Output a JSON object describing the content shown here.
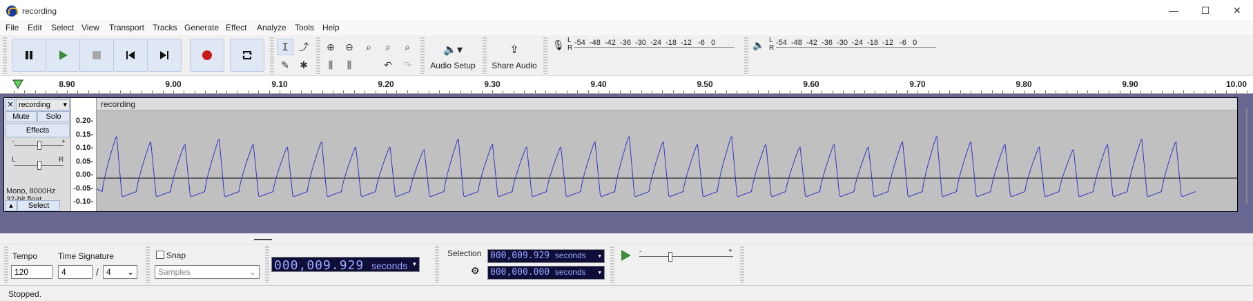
{
  "window": {
    "title": "recording",
    "minimize": "—",
    "maximize": "☐",
    "close": "✕"
  },
  "menu": [
    "File",
    "Edit",
    "Select",
    "View",
    "Transport",
    "Tracks",
    "Generate",
    "Effect",
    "Analyze",
    "Tools",
    "Help"
  ],
  "toolbar": {
    "audio_setup_label": "Audio Setup",
    "share_audio_label": "Share Audio",
    "record_meter_scale": "-54  -48  -42  -36  -30  -24  -18  -12   -6   0",
    "play_meter_scale": "-54  -48  -42  -36  -30  -24  -18  -12   -6   0",
    "meter_lr_top": "L",
    "meter_lr_bottom": "R"
  },
  "timeline": {
    "ticks": [
      "8.90",
      "9.00",
      "9.10",
      "9.20",
      "9.30",
      "9.40",
      "9.50",
      "9.60",
      "9.70",
      "9.80",
      "9.90",
      "10.00"
    ]
  },
  "track": {
    "name": "recording",
    "clip_name": "recording",
    "mute": "Mute",
    "solo": "Solo",
    "effects": "Effects",
    "gain_minus": "-",
    "gain_plus": "+",
    "pan_left": "L",
    "pan_right": "R",
    "info_line1": "Mono, 8000Hz",
    "info_line2": "32-bit float",
    "select": "Select",
    "close": "✕",
    "vruler": [
      "0.20-",
      "0.15-",
      "0.10-",
      "0.05-",
      "0.00-",
      "-0.05-",
      "-0.10-"
    ]
  },
  "bottom": {
    "tempo_label": "Tempo",
    "tempo_value": "120",
    "timesig_label": "Time Signature",
    "timesig_num": "4",
    "timesig_sep": "/",
    "timesig_den": "4",
    "snap_label": "Snap",
    "snap_unit": "Samples",
    "time_value": "000,009.929",
    "time_unit": "seconds",
    "selection_label": "Selection",
    "selection_start": "000,009.929",
    "selection_start_unit": "seconds",
    "selection_end": "000,000.000",
    "selection_end_unit": "seconds"
  },
  "status": {
    "text": "Stopped."
  },
  "colors": {
    "waveform": "#3232c8",
    "track_bg": "#686893",
    "button_bg": "#dfe7f5",
    "record": "#c81818",
    "play": "#3c8c3c"
  }
}
